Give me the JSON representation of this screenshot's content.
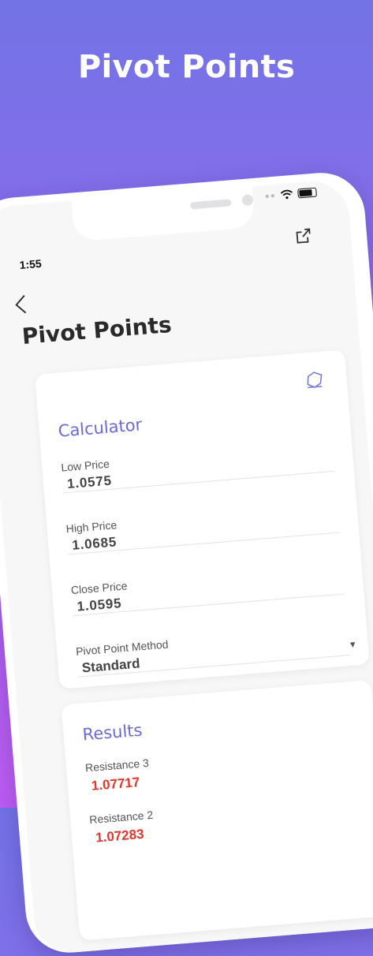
{
  "headline": "Pivot Points",
  "status_bar": {
    "time": "1:55"
  },
  "screen": {
    "title": "Pivot Points"
  },
  "calculator": {
    "title": "Calculator",
    "fields": [
      {
        "label": "Low Price",
        "value": "1.0575"
      },
      {
        "label": "High Price",
        "value": "1.0685"
      },
      {
        "label": "Close Price",
        "value": "1.0595"
      }
    ],
    "method": {
      "label": "Pivot Point Method",
      "value": "Standard"
    }
  },
  "results": {
    "title": "Results",
    "items": [
      {
        "label": "Resistance 3",
        "value": "1.07717"
      },
      {
        "label": "Resistance 2",
        "value": "1.07283"
      }
    ],
    "value_color": "#e2362c"
  },
  "colors": {
    "accent": "#6b6bd6",
    "background_top": "#7373e6",
    "background_bottom": "#bd5cf2"
  },
  "icons": [
    "back-chevron-icon",
    "share-icon",
    "eraser-icon",
    "dropdown-caret-icon",
    "wifi-icon",
    "battery-icon"
  ]
}
